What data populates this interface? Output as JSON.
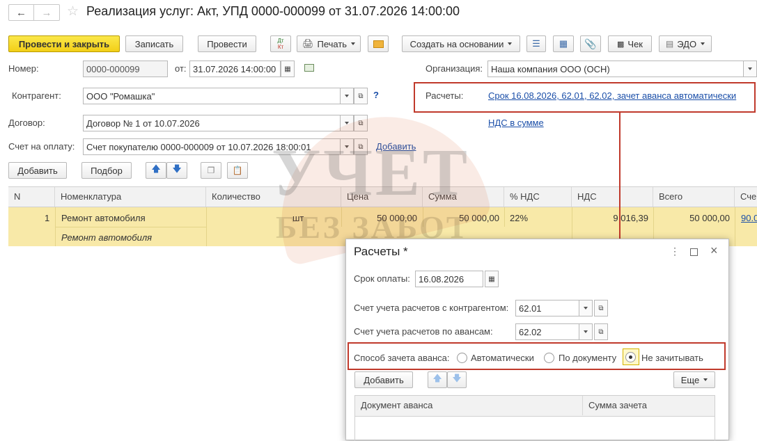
{
  "header": {
    "title": "Реализация услуг: Акт, УПД 0000-000099 от 31.07.2026 14:00:00"
  },
  "toolbar": {
    "post_close": "Провести и закрыть",
    "save": "Записать",
    "post": "Провести",
    "dtkt_top": "Дт",
    "dtkt_bottom": "Кт",
    "print": "Печать",
    "create_based": "Создать на основании",
    "check": "Чек",
    "edo": "ЭДО"
  },
  "form": {
    "number_label": "Номер:",
    "number_value": "0000-000099",
    "date_label": "от:",
    "date_value": "31.07.2026 14:00:00",
    "org_label": "Организация:",
    "org_value": "Наша компания ООО (ОСН)",
    "contractor_label": "Контрагент:",
    "contractor_value": "ООО \"Ромашка\"",
    "help": "?",
    "settlements_label": "Расчеты:",
    "settlements_link": "Срок 16.08.2026, 62.01, 62.02, зачет аванса автоматически",
    "contract_label": "Договор:",
    "contract_value": "Договор № 1 от 10.07.2026",
    "vat_link": "НДС в сумме",
    "invoice_label": "Счет на оплату:",
    "invoice_value": "Счет покупателю 0000-000009 от 10.07.2026 18:00:01",
    "invoice_add": "Добавить"
  },
  "table_toolbar": {
    "add": "Добавить",
    "pick": "Подбор"
  },
  "table": {
    "columns": [
      "N",
      "Номенклатура",
      "Количество",
      "Цена",
      "Сумма",
      "% НДС",
      "НДС",
      "Всего",
      "Сче"
    ],
    "rows": [
      {
        "n": "1",
        "item": "Ремонт автомобиля",
        "item_sub": "Ремонт автомобиля",
        "unit": "шт",
        "price": "50 000,00",
        "sum": "50 000,00",
        "vat_rate": "22%",
        "vat": "9 016,39",
        "total": "50 000,00",
        "account": "90.0"
      }
    ]
  },
  "watermark": {
    "line1": "УЧЕТ",
    "line2": "БЕЗ ЗАБОТ"
  },
  "dialog": {
    "title": "Расчеты *",
    "due_label": "Срок оплаты:",
    "due_value": "16.08.2026",
    "acc_contractor_label": "Счет учета расчетов с контрагентом:",
    "acc_contractor_value": "62.01",
    "acc_advance_label": "Счет учета расчетов по авансам:",
    "acc_advance_value": "62.02",
    "offset_label": "Способ зачета аванса:",
    "offset_options": [
      "Автоматически",
      "По документу",
      "Не зачитывать"
    ],
    "offset_selected": "Не зачитывать",
    "add": "Добавить",
    "more": "Еще",
    "columns": [
      "Документ аванса",
      "Сумма зачета"
    ]
  },
  "colors": {
    "primary_button": "#f2cf17",
    "selected_row": "#f8e9a8",
    "link": "#1a4ea8",
    "highlight_border": "#c0392b"
  }
}
